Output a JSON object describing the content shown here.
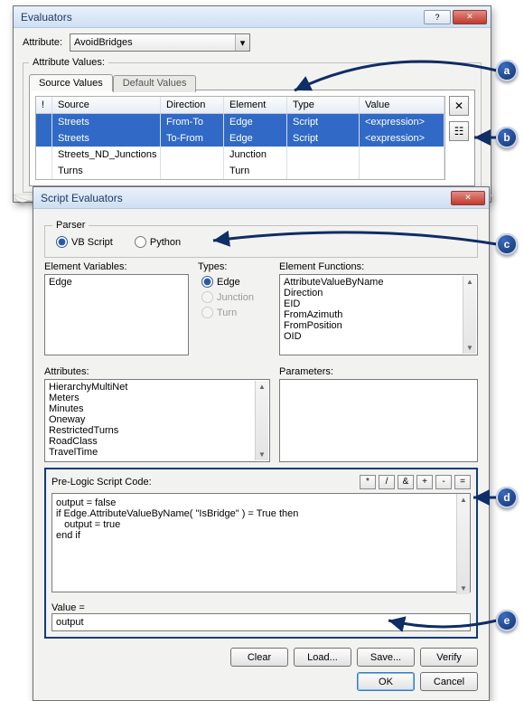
{
  "evaluators": {
    "title": "Evaluators",
    "attribute_label": "Attribute:",
    "attribute_value": "AvoidBridges",
    "attribute_values_label": "Attribute Values:",
    "tabs": {
      "source": "Source Values",
      "default": "Default Values"
    },
    "columns": {
      "bang": "!",
      "source": "Source",
      "direction": "Direction",
      "element": "Element",
      "type": "Type",
      "value": "Value"
    },
    "rows": [
      {
        "source": "Streets",
        "direction": "From-To",
        "element": "Edge",
        "type": "Script",
        "value": "<expression>",
        "selected": true
      },
      {
        "source": "Streets",
        "direction": "To-From",
        "element": "Edge",
        "type": "Script",
        "value": "<expression>",
        "selected": true
      },
      {
        "source": "Streets_ND_Junctions",
        "direction": "",
        "element": "Junction",
        "type": "",
        "value": "",
        "selected": false
      },
      {
        "source": "Turns",
        "direction": "",
        "element": "Turn",
        "type": "",
        "value": "",
        "selected": false
      }
    ],
    "side_buttons": {
      "delete": "×",
      "props": "☰"
    }
  },
  "script_dialog": {
    "title": "Script Evaluators",
    "parser_label": "Parser",
    "parser_options": {
      "vb": "VB Script",
      "py": "Python"
    },
    "parser_selected": "vb",
    "element_variables_label": "Element Variables:",
    "element_variables": [
      "Edge"
    ],
    "types_label": "Types:",
    "types": {
      "edge": "Edge",
      "junction": "Junction",
      "turn": "Turn"
    },
    "types_selected": "edge",
    "element_functions_label": "Element Functions:",
    "element_functions": [
      "AttributeValueByName",
      "Direction",
      "EID",
      "FromAzimuth",
      "FromPosition",
      "OID"
    ],
    "attributes_label": "Attributes:",
    "attributes": [
      "HierarchyMultiNet",
      "Meters",
      "Minutes",
      "Oneway",
      "RestrictedTurns",
      "RoadClass",
      "TravelTime"
    ],
    "parameters_label": "Parameters:",
    "prelogic_label": "Pre-Logic Script Code:",
    "ops": [
      "*",
      "/",
      "&",
      "+",
      "-",
      "="
    ],
    "code": "output = false\nif Edge.AttributeValueByName( \"IsBridge\" ) = True then\n   output = true\nend if",
    "value_label": "Value =",
    "value": "output",
    "buttons": {
      "clear": "Clear",
      "load": "Load...",
      "save": "Save...",
      "verify": "Verify",
      "ok": "OK",
      "cancel": "Cancel"
    }
  },
  "callouts": {
    "a": "a",
    "b": "b",
    "c": "c",
    "d": "d",
    "e": "e"
  }
}
